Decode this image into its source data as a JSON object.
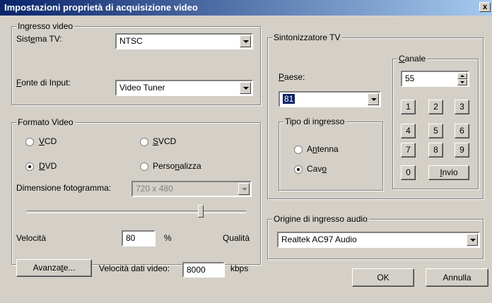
{
  "window": {
    "title": "Impostazioni proprietà di acquisizione video",
    "close_label": "x"
  },
  "ingresso_video": {
    "legend": "Ingresso video",
    "sistema_tv": {
      "label_pre": "Sist",
      "label_u": "e",
      "label_post": "ma TV:",
      "value": "NTSC"
    },
    "fonte_input": {
      "label_u": "F",
      "label_post": "onte di Input:",
      "value": "Video Tuner"
    }
  },
  "formato_video": {
    "legend": "Formato Video",
    "options": {
      "vcd": {
        "u": "V",
        "post": "CD",
        "selected": false
      },
      "svcd": {
        "u": "S",
        "post": "VCD",
        "selected": false
      },
      "dvd": {
        "u": "D",
        "post": "VD",
        "selected": true
      },
      "personalizza": {
        "pre": "Perso",
        "u": "n",
        "post": "alizza",
        "selected": false
      }
    },
    "dimensione": {
      "label_pre": "Dimensione foto",
      "label_u": "g",
      "label_post": "ramma:",
      "value": "720 x 480"
    },
    "slider": {
      "value": 80,
      "min_label": "Velocità",
      "max_label": "Qualità"
    },
    "velocita_value": "80",
    "percent_label": "%"
  },
  "avanzate_button": {
    "pre": "Avanza",
    "u": "t",
    "post": "e..."
  },
  "bitrate": {
    "label": "Velocità dati video:",
    "value": "8000",
    "unit": "kbps"
  },
  "sintonizzatore": {
    "legend": "Sintonizzatore TV",
    "paese": {
      "label_u": "P",
      "label_post": "aese:",
      "value": "81"
    },
    "tipo_ingresso": {
      "legend": "Tipo di ingresso",
      "antenna": {
        "pre": "A",
        "u": "n",
        "post": "tenna",
        "selected": false
      },
      "cavo": {
        "pre": "Cav",
        "u": "o",
        "post": "",
        "selected": true
      }
    },
    "canale": {
      "legend_u": "C",
      "legend_post": "anale",
      "value": "55",
      "keys": [
        "1",
        "2",
        "3",
        "4",
        "5",
        "6",
        "7",
        "8",
        "9",
        "0"
      ],
      "invio": {
        "u": "I",
        "post": "nvio"
      }
    }
  },
  "audio": {
    "legend": "Origine di ingresso audio",
    "value": "Realtek AC97 Audio"
  },
  "ok_button": "OK",
  "annulla_button": "Annulla"
}
